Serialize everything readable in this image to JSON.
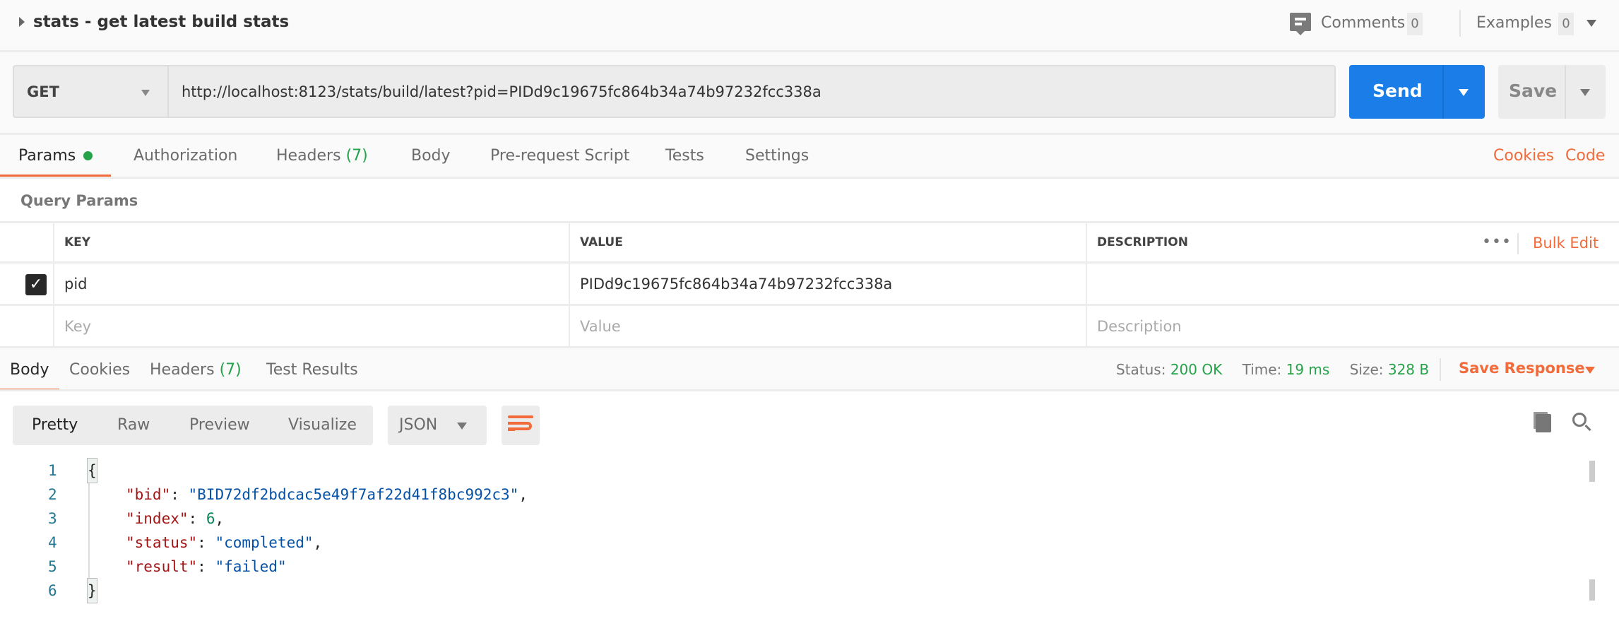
{
  "header": {
    "title": "stats - get latest build stats",
    "comments_label": "Comments",
    "comments_count": "0",
    "examples_label": "Examples",
    "examples_count": "0"
  },
  "request": {
    "method": "GET",
    "url": "http://localhost:8123/stats/build/latest?pid=PIDd9c19675fc864b34a74b97232fcc338a",
    "send_label": "Send",
    "save_label": "Save"
  },
  "request_tabs": [
    {
      "label": "Params"
    },
    {
      "label": "Authorization"
    },
    {
      "label": "Headers",
      "count": "(7)"
    },
    {
      "label": "Body"
    },
    {
      "label": "Pre-request Script"
    },
    {
      "label": "Tests"
    },
    {
      "label": "Settings"
    }
  ],
  "links": {
    "cookies": "Cookies",
    "code": "Code"
  },
  "query_params": {
    "title": "Query Params",
    "columns": [
      "KEY",
      "VALUE",
      "DESCRIPTION"
    ],
    "bulk_edit": "Bulk Edit",
    "rows": [
      {
        "key": "pid",
        "value": "PIDd9c19675fc864b34a74b97232fcc338a",
        "description": "",
        "checked": true
      }
    ],
    "placeholders": {
      "key": "Key",
      "value": "Value",
      "description": "Description"
    }
  },
  "response_tabs": [
    {
      "label": "Body"
    },
    {
      "label": "Cookies"
    },
    {
      "label": "Headers",
      "count": "(7)"
    },
    {
      "label": "Test Results"
    }
  ],
  "response_meta": {
    "status_label": "Status:",
    "status": "200 OK",
    "time_label": "Time:",
    "time": "19 ms",
    "size_label": "Size:",
    "size": "328 B",
    "save_response": "Save Response"
  },
  "view_modes": [
    "Pretty",
    "Raw",
    "Preview",
    "Visualize"
  ],
  "format": "JSON",
  "code": {
    "line_numbers": [
      "1",
      "2",
      "3",
      "4",
      "5",
      "6"
    ],
    "open": "{",
    "close": "}",
    "fields": [
      {
        "key": "\"bid\"",
        "value": "\"BID72df2bdcac5e49f7af22d41f8bc992c3\"",
        "type": "string",
        "comma": ","
      },
      {
        "key": "\"index\"",
        "value": "6",
        "type": "number",
        "comma": ","
      },
      {
        "key": "\"status\"",
        "value": "\"completed\"",
        "type": "string",
        "comma": ","
      },
      {
        "key": "\"result\"",
        "value": "\"failed\"",
        "type": "string",
        "comma": ""
      }
    ]
  },
  "colors": {
    "accent": "#f26b3a",
    "send": "#1a7de8",
    "success": "#26a34a"
  }
}
